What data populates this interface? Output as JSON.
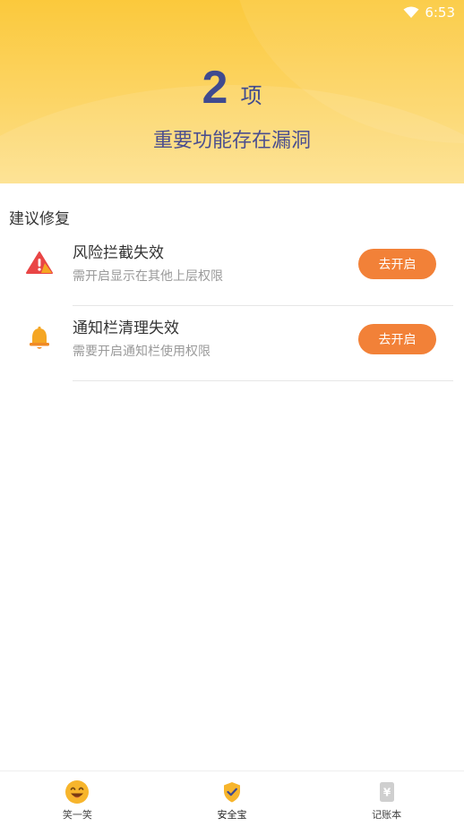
{
  "status_bar": {
    "time": "6:53",
    "wifi_icon": "wifi-icon"
  },
  "header": {
    "count": "2",
    "count_unit": "项",
    "subtitle": "重要功能存在漏洞",
    "colors": {
      "gradient_top": "#fbc93c",
      "gradient_bottom": "#fde08a",
      "text": "#3f4a8f"
    }
  },
  "section": {
    "title": "建议修复",
    "items": [
      {
        "icon": "warning-icon",
        "title": "风险拦截失效",
        "desc": "需开启显示在其他上层权限",
        "action": "去开启"
      },
      {
        "icon": "bell-icon",
        "title": "通知栏清理失效",
        "desc": "需要开启通知栏使用权限",
        "action": "去开启"
      }
    ],
    "button_color": "#f28138"
  },
  "tabbar": {
    "tabs": [
      {
        "icon": "smiley-icon",
        "label": "笑一笑"
      },
      {
        "icon": "shield-check-icon",
        "label": "安全宝"
      },
      {
        "icon": "ledger-icon",
        "label": "记账本"
      }
    ]
  }
}
